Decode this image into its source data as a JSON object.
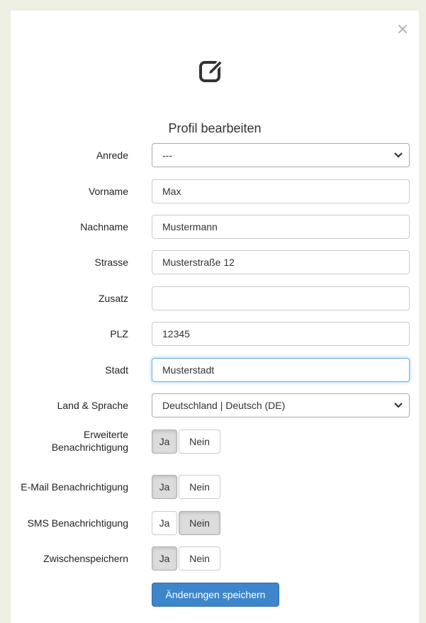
{
  "dialog": {
    "title": "Profil bearbeiten",
    "header_icon": "edit-square-icon",
    "close_icon": "close-icon"
  },
  "fields": {
    "anrede": {
      "label": "Anrede",
      "value": "---"
    },
    "vorname": {
      "label": "Vorname",
      "value": "Max"
    },
    "nachname": {
      "label": "Nachname",
      "value": "Mustermann"
    },
    "strasse": {
      "label": "Strasse",
      "value": "Musterstraße 12"
    },
    "zusatz": {
      "label": "Zusatz",
      "value": ""
    },
    "plz": {
      "label": "PLZ",
      "value": "12345"
    },
    "stadt": {
      "label": "Stadt",
      "value": "Musterstadt"
    },
    "land": {
      "label": "Land & Sprache",
      "value": "Deutschland | Deutsch (DE)"
    }
  },
  "toggles": {
    "erweitert": {
      "label_line1": "Erweiterte",
      "label_line2": "Benachrichtigung",
      "yes": "Ja",
      "no": "Nein",
      "selected": "Ja"
    },
    "email": {
      "label": "E-Mail Benachrichtigung",
      "yes": "Ja",
      "no": "Nein",
      "selected": "Ja"
    },
    "sms": {
      "label": "SMS Benachrichtigung",
      "yes": "Ja",
      "no": "Nein",
      "selected": "Nein"
    },
    "zwischen": {
      "label": "Zwischenspeichern",
      "yes": "Ja",
      "no": "Nein",
      "selected": "Ja"
    }
  },
  "actions": {
    "save_label": "Änderungen speichern"
  },
  "colors": {
    "primary": "#3d86cc",
    "backdrop": "#eef0e4",
    "focus": "#66afe9"
  }
}
